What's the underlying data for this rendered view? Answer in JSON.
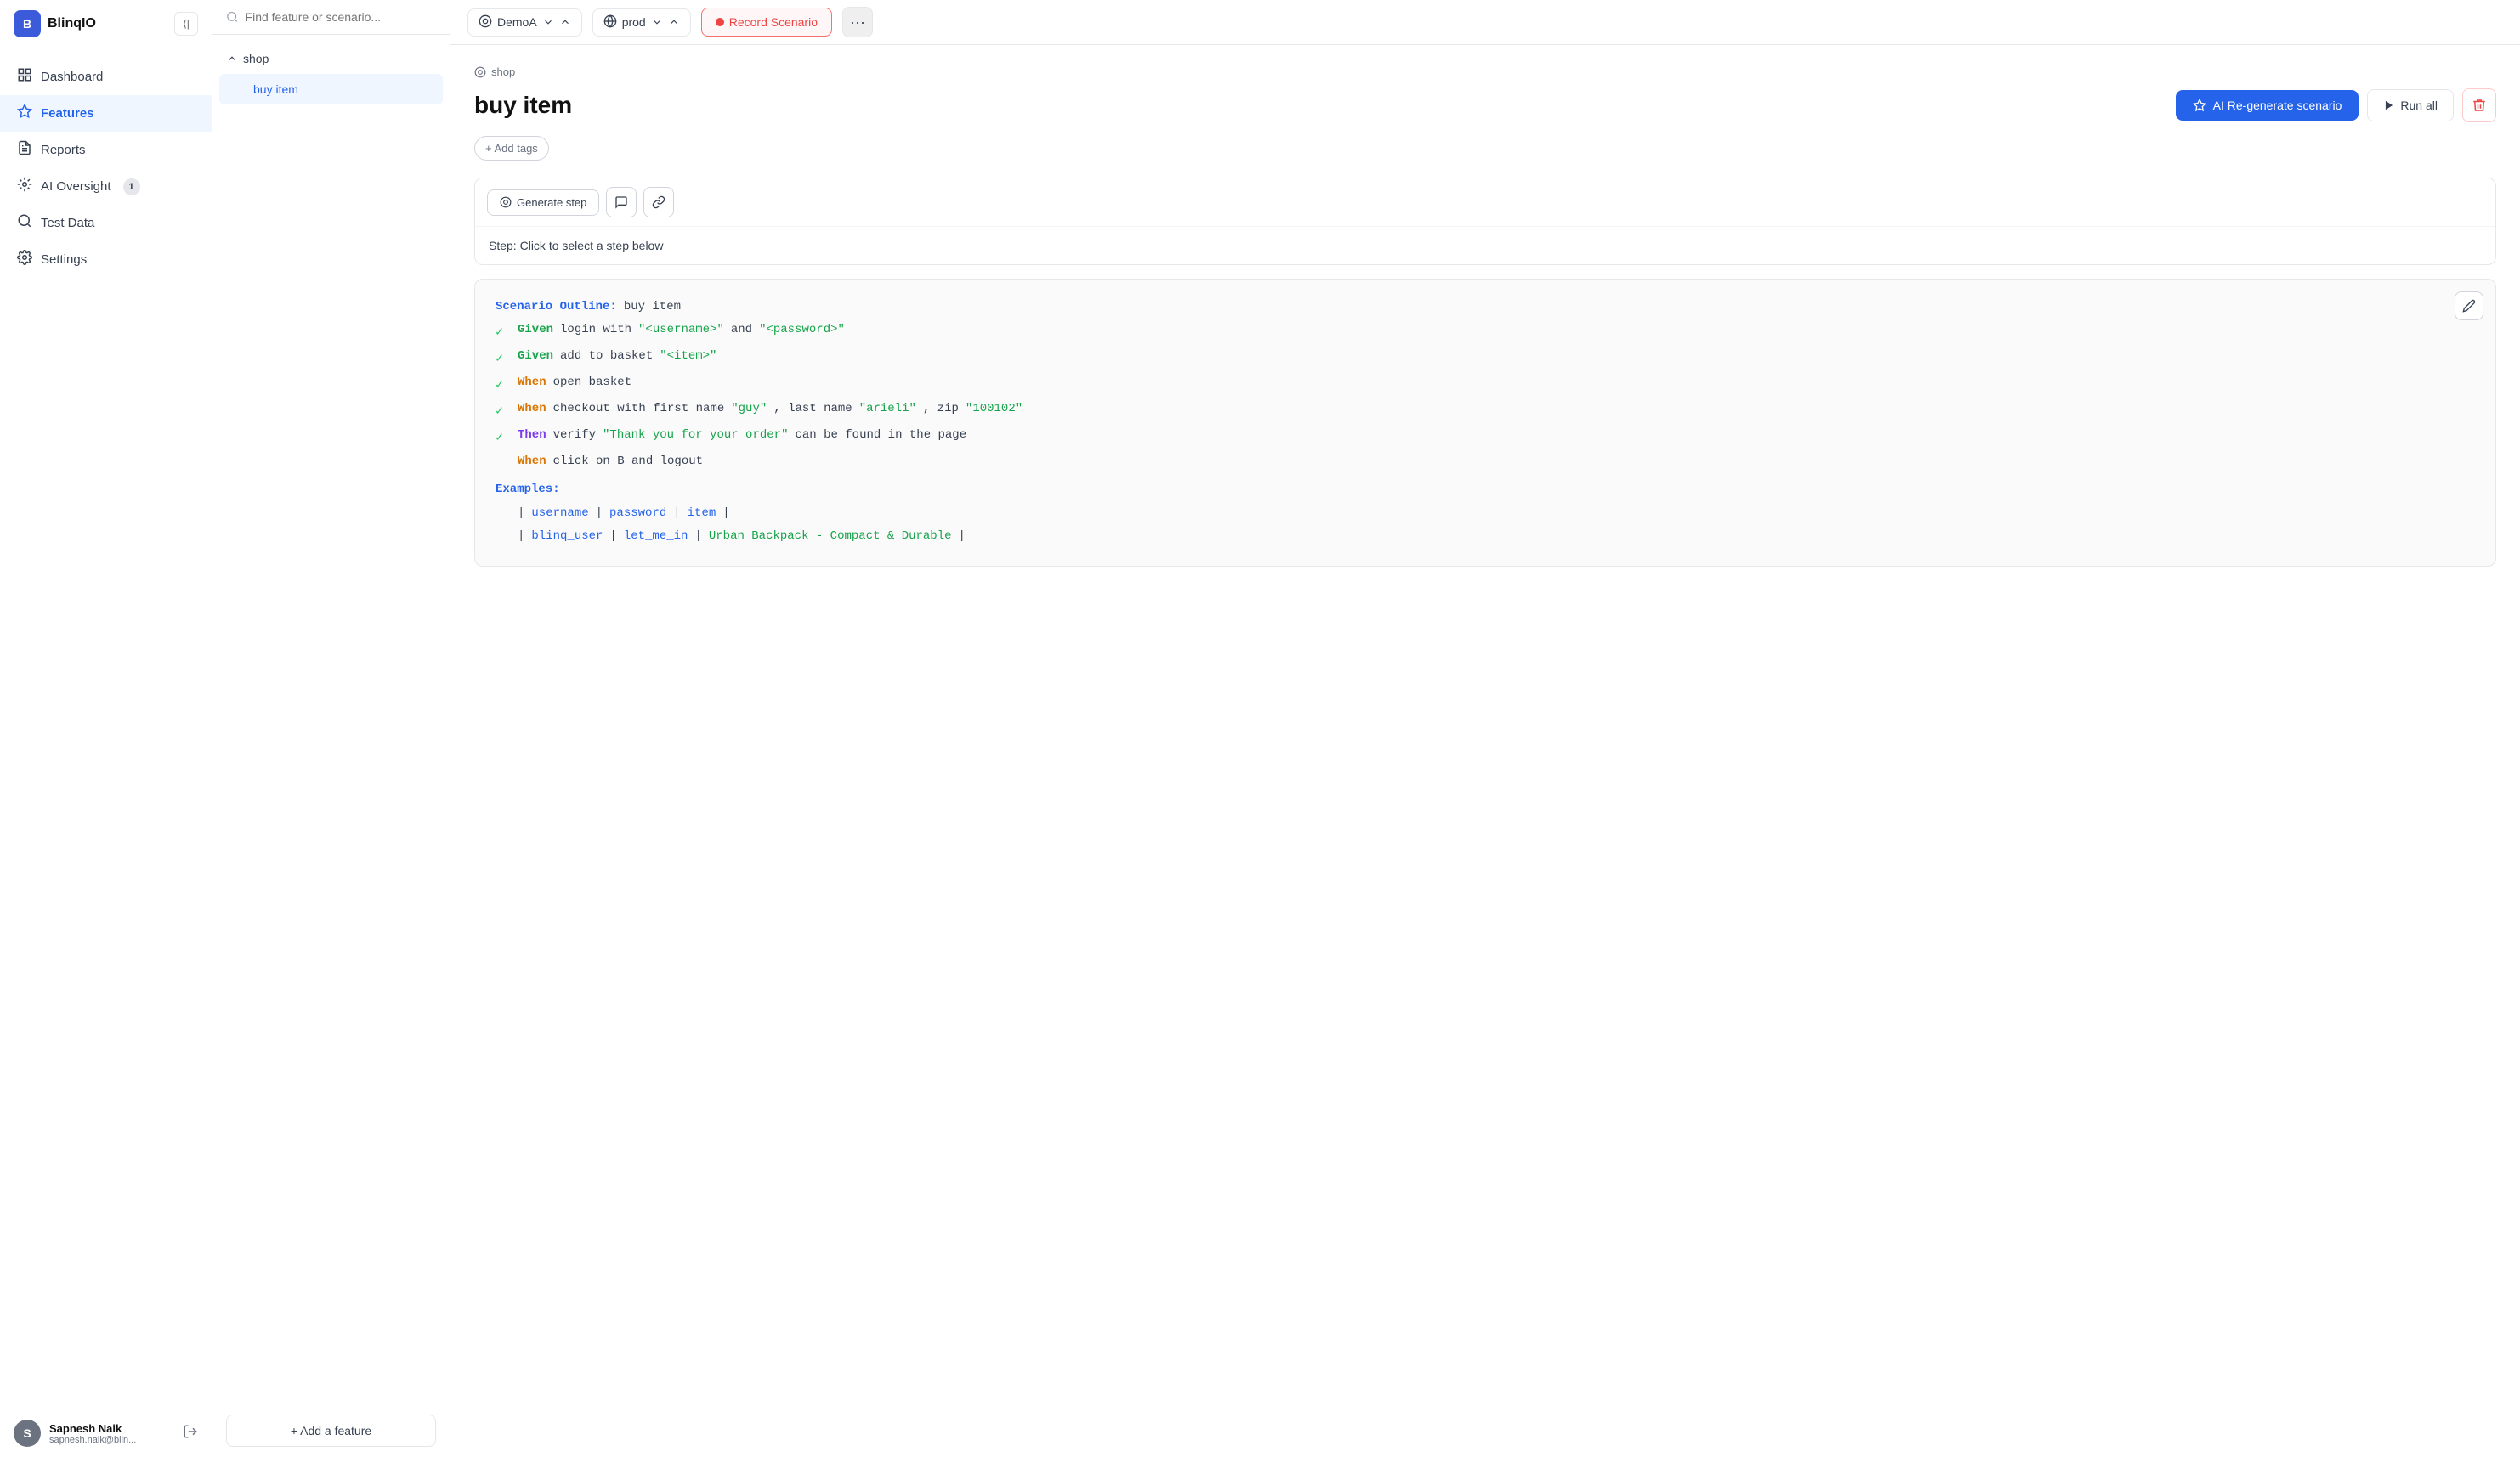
{
  "app": {
    "name": "BlinqIO",
    "logo_letter": "B"
  },
  "sidebar": {
    "nav_items": [
      {
        "id": "dashboard",
        "label": "Dashboard",
        "icon": "⌂",
        "active": false,
        "badge": null
      },
      {
        "id": "features",
        "label": "Features",
        "icon": "◈",
        "active": true,
        "badge": null
      },
      {
        "id": "reports",
        "label": "Reports",
        "icon": "☰",
        "active": false,
        "badge": null
      },
      {
        "id": "ai-oversight",
        "label": "AI Oversight",
        "icon": "⚙",
        "active": false,
        "badge": "1"
      },
      {
        "id": "test-data",
        "label": "Test Data",
        "icon": "🔍",
        "active": false,
        "badge": null
      },
      {
        "id": "settings",
        "label": "Settings",
        "icon": "⚙",
        "active": false,
        "badge": null
      }
    ],
    "user": {
      "name": "Sapnesh Naik",
      "email": "sapnesh.naik@blin...",
      "avatar_letter": "S"
    }
  },
  "middle_panel": {
    "search_placeholder": "Find feature or scenario...",
    "tree": {
      "group_name": "shop",
      "items": [
        {
          "id": "buy-item",
          "label": "buy item",
          "active": true
        }
      ]
    },
    "add_feature_label": "+ Add a feature"
  },
  "topbar": {
    "demo_selector": "DemoA",
    "env_selector": "prod",
    "record_btn_label": "Record Scenario"
  },
  "page": {
    "breadcrumb": "shop",
    "title": "buy item",
    "add_tags_label": "+ Add tags",
    "regen_btn_label": "AI  Re-generate scenario",
    "run_all_label": "Run all",
    "step_hint": "Step:",
    "step_hint_sub": "Click to select a step below",
    "generate_step_label": "Generate step",
    "scenario": {
      "outline_prefix": "Scenario Outline:",
      "outline_name": "buy item",
      "steps": [
        {
          "checked": true,
          "keyword": "Given",
          "text": " login with ",
          "strings": [
            "\"<username>\"",
            "\"<password>\""
          ],
          "between": " and "
        },
        {
          "checked": true,
          "keyword": "Given",
          "text": " add to basket ",
          "strings": [
            "\"<item>\""
          ]
        },
        {
          "checked": true,
          "keyword": "When",
          "text": " open basket",
          "strings": []
        },
        {
          "checked": true,
          "keyword": "When",
          "text": " checkout with first name ",
          "strings": [
            "\"guy\"",
            "\"arieli\"",
            "\"100102\""
          ],
          "labels": [
            ", last name ",
            ", zip "
          ]
        },
        {
          "checked": true,
          "keyword": "Then",
          "text": " verify ",
          "strings": [
            "\"Thank you for your order\""
          ],
          "after": " can be found in the page"
        }
      ],
      "unchecked_step": {
        "keyword": "When",
        "text": " click on B and logout"
      },
      "examples_label": "Examples:",
      "table": {
        "headers": [
          "username",
          "password",
          "item"
        ],
        "rows": [
          [
            "blinq_user",
            "let_me_in",
            "Urban Backpack - Compact & Durable"
          ]
        ]
      }
    }
  }
}
